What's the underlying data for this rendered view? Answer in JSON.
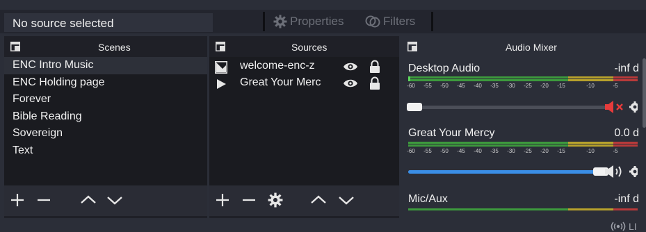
{
  "toolbar": {
    "source_status": "No source selected",
    "properties_label": "Properties",
    "filters_label": "Filters"
  },
  "scenes": {
    "title": "Scenes",
    "items": [
      {
        "label": "ENC Intro Music",
        "selected": true
      },
      {
        "label": "ENC Holding page",
        "selected": false
      },
      {
        "label": "Forever",
        "selected": false
      },
      {
        "label": "Bible Reading",
        "selected": false
      },
      {
        "label": "Sovereign",
        "selected": false
      },
      {
        "label": "Text",
        "selected": false
      }
    ]
  },
  "sources": {
    "title": "Sources",
    "items": [
      {
        "label": "welcome-enc-z",
        "type_icon": "image-icon",
        "visible": true,
        "locked": true
      },
      {
        "label": "Great Your Merc",
        "type_icon": "media-play-icon",
        "visible": true,
        "locked": true
      }
    ]
  },
  "audio_mixer": {
    "title": "Audio Mixer",
    "meter_ticks": [
      "-60",
      "-55",
      "-50",
      "-45",
      "-40",
      "-35",
      "-30",
      "-25",
      "-20",
      "-15",
      "-10",
      "-5"
    ],
    "channels": [
      {
        "name": "Desktop Audio",
        "db": "-inf d",
        "muted": true,
        "volume_fraction": 0.0
      },
      {
        "name": "Great Your Mercy",
        "db": "0.0 d",
        "muted": false,
        "volume_fraction": 1.0
      },
      {
        "name": "Mic/Aux",
        "db": "-inf d",
        "muted": false
      }
    ]
  },
  "statusbar": {
    "live_label": "LI"
  },
  "colors": {
    "accent_blue": "#3a8ee6",
    "meter_green": "#3d9a3d",
    "meter_yellow": "#b8a22c",
    "meter_red": "#b83a3a",
    "mute_red": "#e63b3b"
  }
}
